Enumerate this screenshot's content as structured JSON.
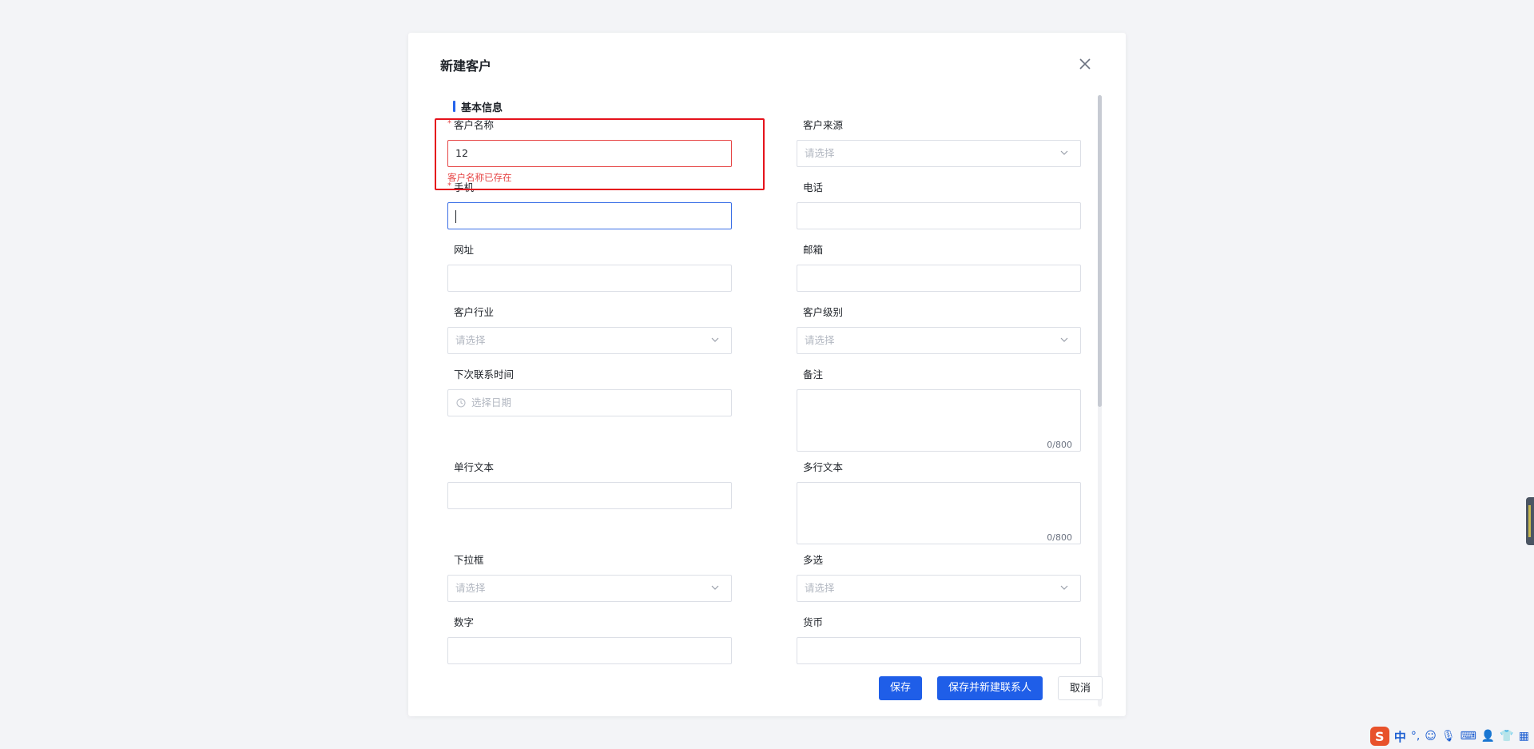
{
  "dialog": {
    "title": "新建客户",
    "section_title": "基本信息"
  },
  "fields": {
    "customer_name": {
      "label": "客户名称",
      "value": "12",
      "required": true,
      "error": "客户名称已存在"
    },
    "customer_source": {
      "label": "客户来源",
      "placeholder": "请选择"
    },
    "mobile": {
      "label": "手机",
      "value": "",
      "required": true
    },
    "phone": {
      "label": "电话",
      "value": ""
    },
    "website": {
      "label": "网址",
      "value": ""
    },
    "email": {
      "label": "邮箱",
      "value": ""
    },
    "industry": {
      "label": "客户行业",
      "placeholder": "请选择"
    },
    "level": {
      "label": "客户级别",
      "placeholder": "请选择"
    },
    "next_contact": {
      "label": "下次联系时间",
      "placeholder": "选择日期"
    },
    "remark": {
      "label": "备注",
      "counter": "0/800"
    },
    "single_text": {
      "label": "单行文本",
      "value": ""
    },
    "multi_text": {
      "label": "多行文本",
      "counter": "0/800"
    },
    "dropdown": {
      "label": "下拉框",
      "placeholder": "请选择"
    },
    "multi_select": {
      "label": "多选",
      "placeholder": "请选择"
    },
    "number": {
      "label": "数字",
      "value": ""
    },
    "currency": {
      "label": "货币",
      "value": ""
    }
  },
  "footer": {
    "save": "保存",
    "save_and_new_contact": "保存并新建联系人",
    "cancel": "取消"
  },
  "ime": {
    "logo": "S",
    "lang": "中",
    "punct": "°,"
  },
  "colors": {
    "primary": "#1f5ee8",
    "error": "#e64545",
    "annotation": "#e5121c"
  }
}
